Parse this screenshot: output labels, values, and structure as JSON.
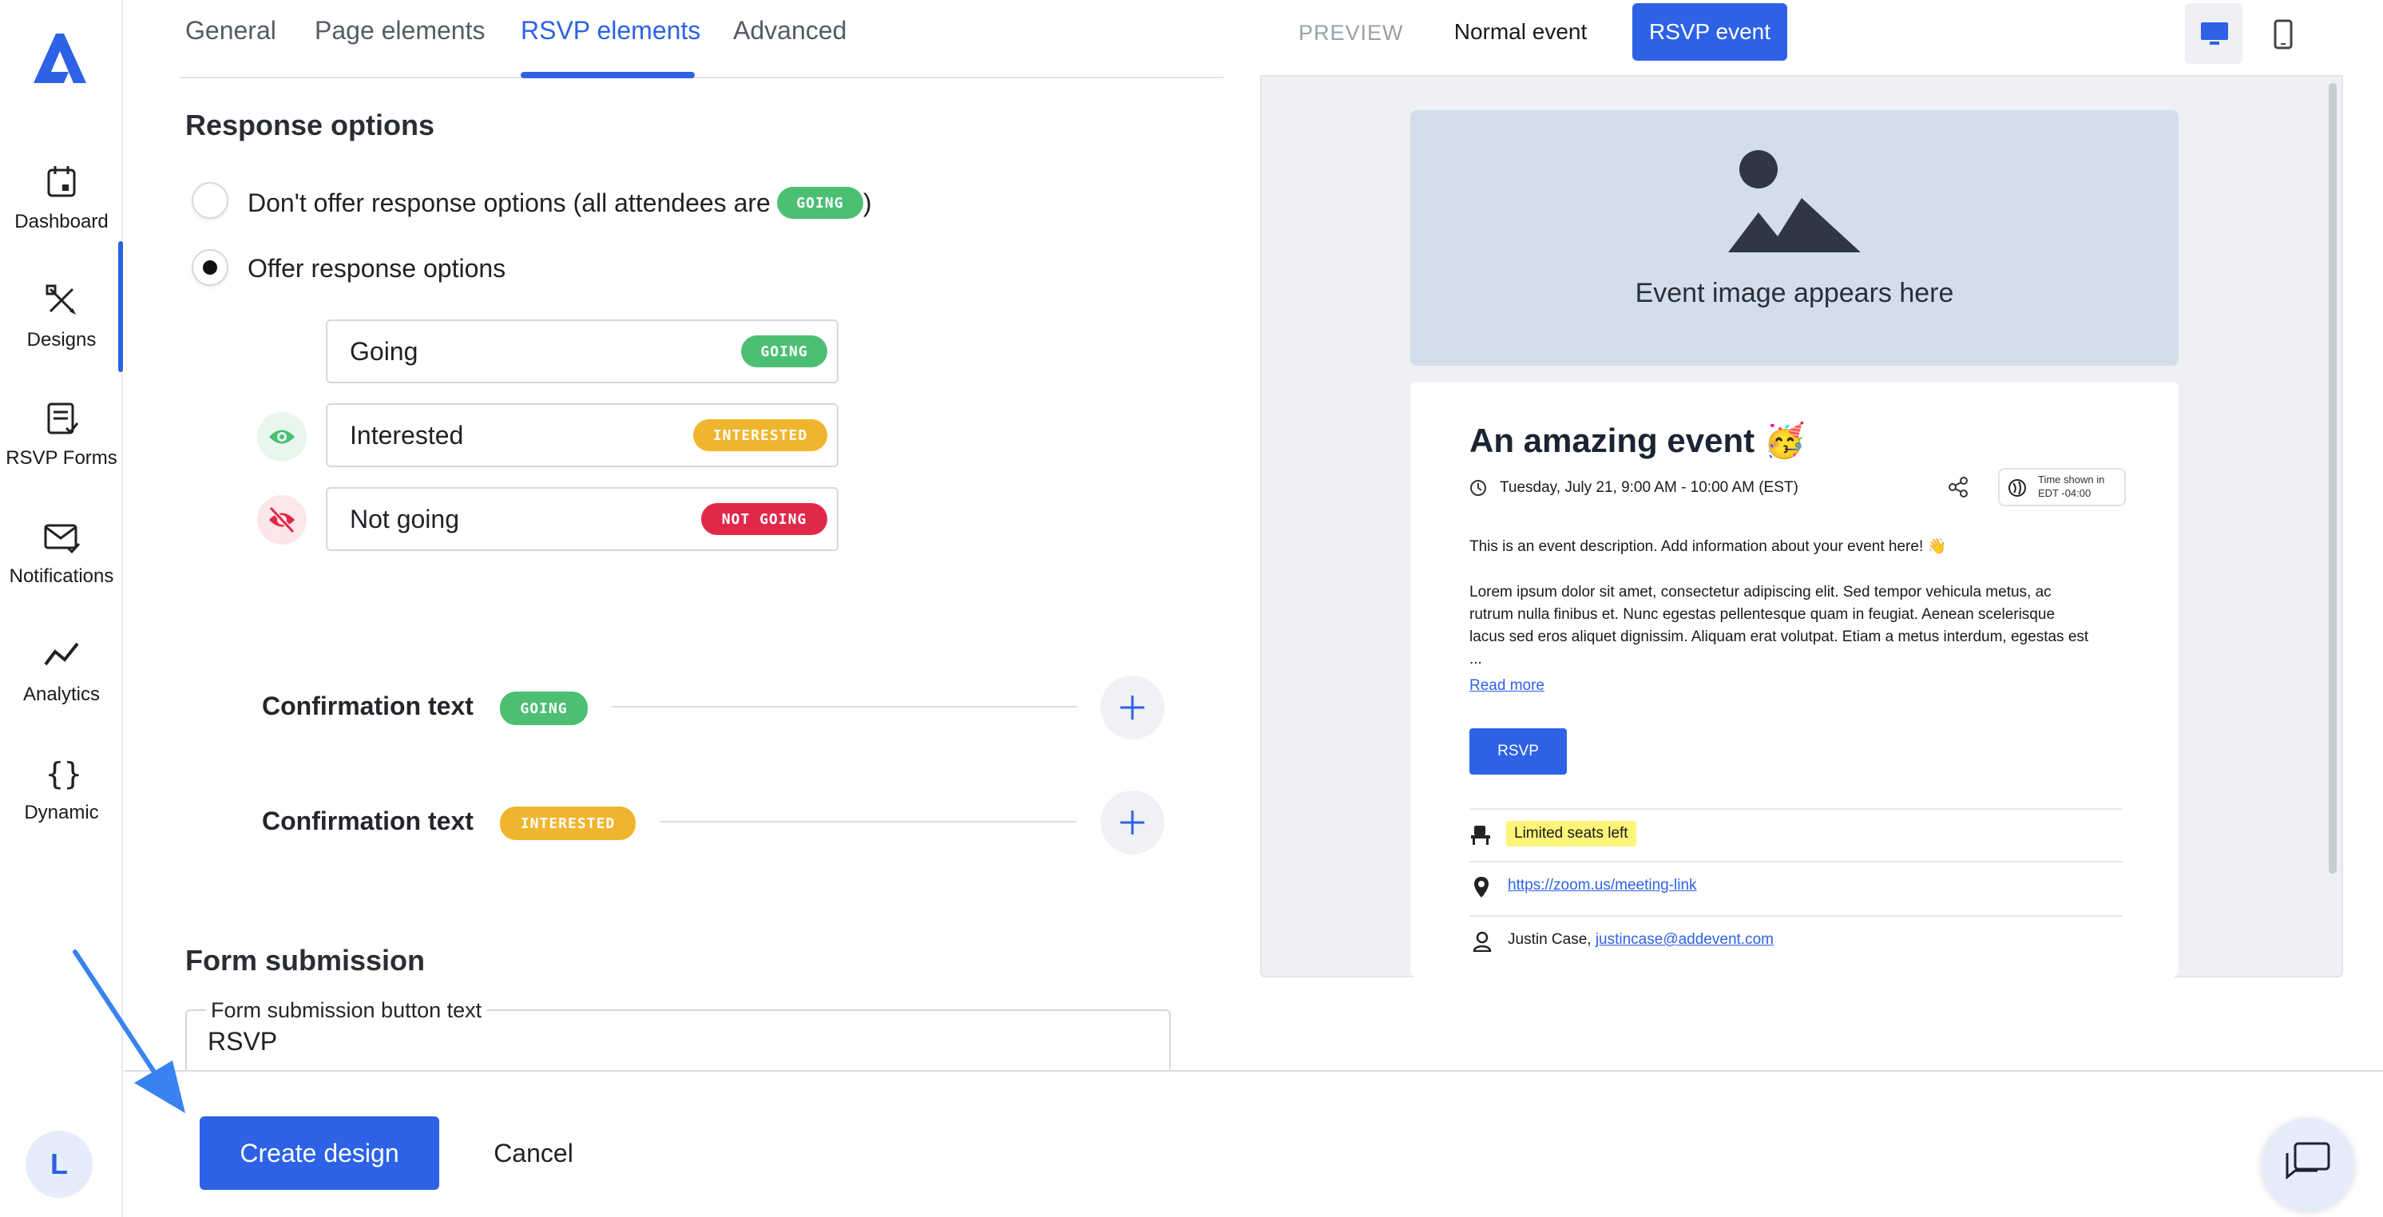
{
  "sidebar": {
    "items": [
      {
        "label": "Dashboard",
        "icon": "calendar-icon"
      },
      {
        "label": "Designs",
        "icon": "pencil-ruler-icon"
      },
      {
        "label": "RSVP Forms",
        "icon": "form-check-icon"
      },
      {
        "label": "Notifications",
        "icon": "envelope-check-icon"
      },
      {
        "label": "Analytics",
        "icon": "trend-line-icon"
      },
      {
        "label": "Dynamic",
        "icon": "curly-braces-icon"
      }
    ],
    "active": "Designs",
    "avatar_letter": "L"
  },
  "tabs": [
    {
      "label": "General"
    },
    {
      "label": "Page elements"
    },
    {
      "label": "RSVP elements"
    },
    {
      "label": "Advanced"
    }
  ],
  "response_options": {
    "heading": "Response options",
    "opt1_prefix": "Don't offer response options (all attendees are",
    "opt1_badge": "GOING",
    "opt1_suffix": ")",
    "opt2": "Offer response options",
    "options": [
      {
        "label": "Going",
        "badge": "GOING"
      },
      {
        "label": "Interested",
        "badge": "INTERESTED"
      },
      {
        "label": "Not going",
        "badge": "NOT GOING"
      }
    ]
  },
  "confirmation": [
    {
      "label": "Confirmation text",
      "badge": "GOING"
    },
    {
      "label": "Confirmation text",
      "badge": "INTERESTED"
    }
  ],
  "form_submission": {
    "heading": "Form submission",
    "field_label": "Form submission button text",
    "field_value": "RSVP"
  },
  "footer": {
    "create": "Create design",
    "cancel": "Cancel"
  },
  "preview": {
    "label": "PREVIEW",
    "normal": "Normal event",
    "rsvp": "RSVP event",
    "image_text": "Event image appears here",
    "title": "An amazing event 🥳",
    "datetime": "Tuesday, July 21, 9:00 AM - 10:00 AM (EST)",
    "tz_line1": "Time shown in",
    "tz_line2": "EDT -04:00",
    "desc1": "This is an event description. Add information about your event here! 👋",
    "desc2_l1": "Lorem ipsum dolor sit amet, consectetur adipiscing elit. Sed tempor vehicula metus, ac",
    "desc2_l2": "rutrum nulla finibus et. Nunc egestas pellentesque quam in feugiat. Aenean scelerisque",
    "desc2_l3": "lacus sed eros aliquet dignissim. Aliquam erat volutpat. Etiam a metus interdum, egestas est",
    "desc2_l4": "...",
    "read_more": "Read more",
    "rsvp_button": "RSVP",
    "seats": "Limited seats left",
    "location": "https://zoom.us/meeting-link",
    "host_name": "Justin Case,",
    "host_email": "justincase@addevent.com"
  },
  "colors": {
    "accent": "#2d62e6",
    "going": "#4cbf72",
    "interested": "#f0b52e",
    "not_going": "#e0294a"
  }
}
